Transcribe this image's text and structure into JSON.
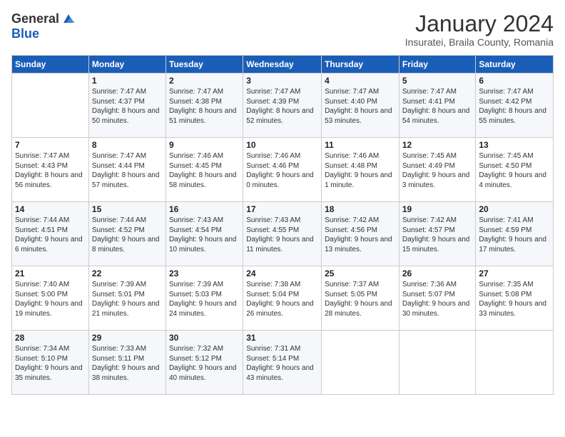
{
  "header": {
    "logo_general": "General",
    "logo_blue": "Blue",
    "month_title": "January 2024",
    "subtitle": "Insuratei, Braila County, Romania"
  },
  "days_of_week": [
    "Sunday",
    "Monday",
    "Tuesday",
    "Wednesday",
    "Thursday",
    "Friday",
    "Saturday"
  ],
  "weeks": [
    [
      {
        "day": "",
        "sunrise": "",
        "sunset": "",
        "daylight": ""
      },
      {
        "day": "1",
        "sunrise": "Sunrise: 7:47 AM",
        "sunset": "Sunset: 4:37 PM",
        "daylight": "Daylight: 8 hours and 50 minutes."
      },
      {
        "day": "2",
        "sunrise": "Sunrise: 7:47 AM",
        "sunset": "Sunset: 4:38 PM",
        "daylight": "Daylight: 8 hours and 51 minutes."
      },
      {
        "day": "3",
        "sunrise": "Sunrise: 7:47 AM",
        "sunset": "Sunset: 4:39 PM",
        "daylight": "Daylight: 8 hours and 52 minutes."
      },
      {
        "day": "4",
        "sunrise": "Sunrise: 7:47 AM",
        "sunset": "Sunset: 4:40 PM",
        "daylight": "Daylight: 8 hours and 53 minutes."
      },
      {
        "day": "5",
        "sunrise": "Sunrise: 7:47 AM",
        "sunset": "Sunset: 4:41 PM",
        "daylight": "Daylight: 8 hours and 54 minutes."
      },
      {
        "day": "6",
        "sunrise": "Sunrise: 7:47 AM",
        "sunset": "Sunset: 4:42 PM",
        "daylight": "Daylight: 8 hours and 55 minutes."
      }
    ],
    [
      {
        "day": "7",
        "sunrise": "Sunrise: 7:47 AM",
        "sunset": "Sunset: 4:43 PM",
        "daylight": "Daylight: 8 hours and 56 minutes."
      },
      {
        "day": "8",
        "sunrise": "Sunrise: 7:47 AM",
        "sunset": "Sunset: 4:44 PM",
        "daylight": "Daylight: 8 hours and 57 minutes."
      },
      {
        "day": "9",
        "sunrise": "Sunrise: 7:46 AM",
        "sunset": "Sunset: 4:45 PM",
        "daylight": "Daylight: 8 hours and 58 minutes."
      },
      {
        "day": "10",
        "sunrise": "Sunrise: 7:46 AM",
        "sunset": "Sunset: 4:46 PM",
        "daylight": "Daylight: 9 hours and 0 minutes."
      },
      {
        "day": "11",
        "sunrise": "Sunrise: 7:46 AM",
        "sunset": "Sunset: 4:48 PM",
        "daylight": "Daylight: 9 hours and 1 minute."
      },
      {
        "day": "12",
        "sunrise": "Sunrise: 7:45 AM",
        "sunset": "Sunset: 4:49 PM",
        "daylight": "Daylight: 9 hours and 3 minutes."
      },
      {
        "day": "13",
        "sunrise": "Sunrise: 7:45 AM",
        "sunset": "Sunset: 4:50 PM",
        "daylight": "Daylight: 9 hours and 4 minutes."
      }
    ],
    [
      {
        "day": "14",
        "sunrise": "Sunrise: 7:44 AM",
        "sunset": "Sunset: 4:51 PM",
        "daylight": "Daylight: 9 hours and 6 minutes."
      },
      {
        "day": "15",
        "sunrise": "Sunrise: 7:44 AM",
        "sunset": "Sunset: 4:52 PM",
        "daylight": "Daylight: 9 hours and 8 minutes."
      },
      {
        "day": "16",
        "sunrise": "Sunrise: 7:43 AM",
        "sunset": "Sunset: 4:54 PM",
        "daylight": "Daylight: 9 hours and 10 minutes."
      },
      {
        "day": "17",
        "sunrise": "Sunrise: 7:43 AM",
        "sunset": "Sunset: 4:55 PM",
        "daylight": "Daylight: 9 hours and 11 minutes."
      },
      {
        "day": "18",
        "sunrise": "Sunrise: 7:42 AM",
        "sunset": "Sunset: 4:56 PM",
        "daylight": "Daylight: 9 hours and 13 minutes."
      },
      {
        "day": "19",
        "sunrise": "Sunrise: 7:42 AM",
        "sunset": "Sunset: 4:57 PM",
        "daylight": "Daylight: 9 hours and 15 minutes."
      },
      {
        "day": "20",
        "sunrise": "Sunrise: 7:41 AM",
        "sunset": "Sunset: 4:59 PM",
        "daylight": "Daylight: 9 hours and 17 minutes."
      }
    ],
    [
      {
        "day": "21",
        "sunrise": "Sunrise: 7:40 AM",
        "sunset": "Sunset: 5:00 PM",
        "daylight": "Daylight: 9 hours and 19 minutes."
      },
      {
        "day": "22",
        "sunrise": "Sunrise: 7:39 AM",
        "sunset": "Sunset: 5:01 PM",
        "daylight": "Daylight: 9 hours and 21 minutes."
      },
      {
        "day": "23",
        "sunrise": "Sunrise: 7:39 AM",
        "sunset": "Sunset: 5:03 PM",
        "daylight": "Daylight: 9 hours and 24 minutes."
      },
      {
        "day": "24",
        "sunrise": "Sunrise: 7:38 AM",
        "sunset": "Sunset: 5:04 PM",
        "daylight": "Daylight: 9 hours and 26 minutes."
      },
      {
        "day": "25",
        "sunrise": "Sunrise: 7:37 AM",
        "sunset": "Sunset: 5:05 PM",
        "daylight": "Daylight: 9 hours and 28 minutes."
      },
      {
        "day": "26",
        "sunrise": "Sunrise: 7:36 AM",
        "sunset": "Sunset: 5:07 PM",
        "daylight": "Daylight: 9 hours and 30 minutes."
      },
      {
        "day": "27",
        "sunrise": "Sunrise: 7:35 AM",
        "sunset": "Sunset: 5:08 PM",
        "daylight": "Daylight: 9 hours and 33 minutes."
      }
    ],
    [
      {
        "day": "28",
        "sunrise": "Sunrise: 7:34 AM",
        "sunset": "Sunset: 5:10 PM",
        "daylight": "Daylight: 9 hours and 35 minutes."
      },
      {
        "day": "29",
        "sunrise": "Sunrise: 7:33 AM",
        "sunset": "Sunset: 5:11 PM",
        "daylight": "Daylight: 9 hours and 38 minutes."
      },
      {
        "day": "30",
        "sunrise": "Sunrise: 7:32 AM",
        "sunset": "Sunset: 5:12 PM",
        "daylight": "Daylight: 9 hours and 40 minutes."
      },
      {
        "day": "31",
        "sunrise": "Sunrise: 7:31 AM",
        "sunset": "Sunset: 5:14 PM",
        "daylight": "Daylight: 9 hours and 43 minutes."
      },
      {
        "day": "",
        "sunrise": "",
        "sunset": "",
        "daylight": ""
      },
      {
        "day": "",
        "sunrise": "",
        "sunset": "",
        "daylight": ""
      },
      {
        "day": "",
        "sunrise": "",
        "sunset": "",
        "daylight": ""
      }
    ]
  ]
}
